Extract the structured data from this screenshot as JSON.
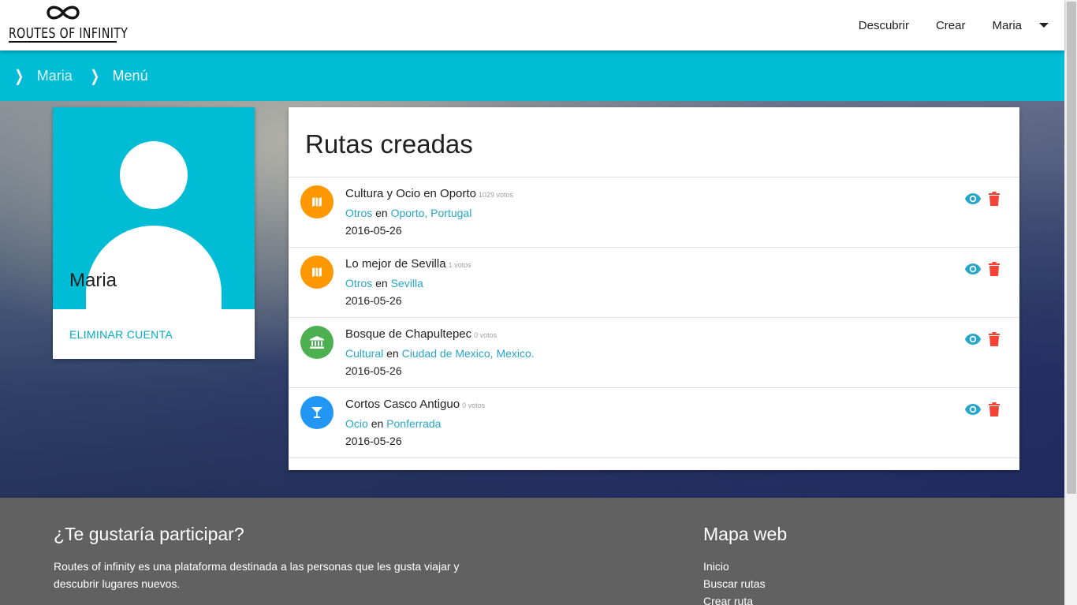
{
  "header": {
    "logo_text": "ROUTES OF INFINITY",
    "nav": [
      "Descubrir",
      "Crear",
      "Maria"
    ]
  },
  "breadcrumb": [
    "Maria",
    "Menú"
  ],
  "profile": {
    "name": "Maria",
    "delete_label": "ELIMINAR CUENTA"
  },
  "routes": {
    "title": "Rutas creadas",
    "items": [
      {
        "title": "Cultura y Ocio en Oporto",
        "votes": "1029 votos",
        "category": "Otros",
        "connector": "en",
        "location": "Oporto, Portugal",
        "date": "2016-05-26",
        "icon": "map-icon",
        "color": "#ff9800"
      },
      {
        "title": "Lo mejor de Sevilla",
        "votes": "1 votos",
        "category": "Otros",
        "connector": "en",
        "location": "Sevilla",
        "date": "2016-05-26",
        "icon": "map-icon",
        "color": "#ff9800"
      },
      {
        "title": "Bosque de Chapultepec",
        "votes": "0 votos",
        "category": "Cultural",
        "connector": "en",
        "location": "Ciudad de Mexico, Mexico.",
        "date": "2016-05-26",
        "icon": "museum-icon",
        "color": "#4caf50"
      },
      {
        "title": "Cortos Casco Antiguo",
        "votes": "0 votos",
        "category": "Ocio",
        "connector": "en",
        "location": "Ponferrada",
        "date": "2016-05-26",
        "icon": "cocktail-icon",
        "color": "#2196f3"
      }
    ]
  },
  "footer": {
    "about_title": "¿Te gustaría participar?",
    "about_text": "Routes of infinity es una plataforma destinada a las personas que les gusta viajar y descubrir lugares nuevos.",
    "sitemap_title": "Mapa web",
    "links": [
      "Inicio",
      "Buscar rutas",
      "Crear ruta"
    ]
  },
  "colors": {
    "accent": "#00bcd4",
    "link": "#26a6c9",
    "delete": "#f44336",
    "footer": "#616161"
  }
}
